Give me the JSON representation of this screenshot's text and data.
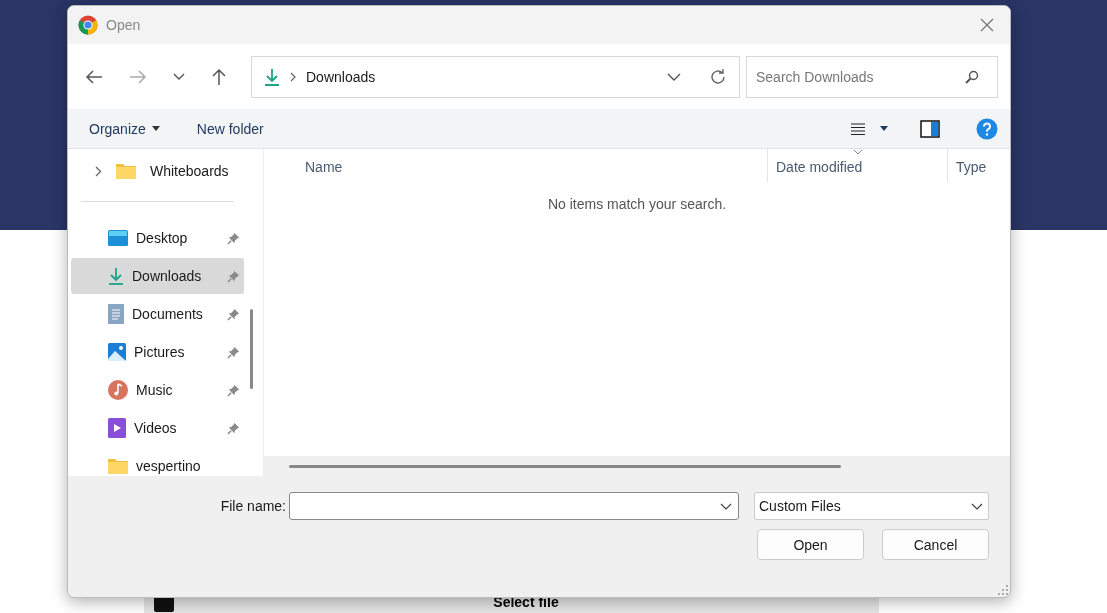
{
  "page": {
    "button": "Select file"
  },
  "dialog": {
    "title": "Open",
    "nav": {
      "path": "Downloads",
      "search_placeholder": "Search Downloads"
    },
    "toolbar": {
      "organize": "Organize",
      "new_folder": "New folder"
    },
    "sidebar": {
      "tree": [
        {
          "label": "Whiteboards",
          "kind": "folder",
          "expanded": false
        }
      ],
      "quick_access": [
        {
          "label": "Desktop",
          "kind": "desktop",
          "selected": false,
          "pinned": true
        },
        {
          "label": "Downloads",
          "kind": "downloads",
          "selected": true,
          "pinned": true
        },
        {
          "label": "Documents",
          "kind": "documents",
          "selected": false,
          "pinned": true
        },
        {
          "label": "Pictures",
          "kind": "pictures",
          "selected": false,
          "pinned": true
        },
        {
          "label": "Music",
          "kind": "music",
          "selected": false,
          "pinned": true
        },
        {
          "label": "Videos",
          "kind": "videos",
          "selected": false,
          "pinned": true
        },
        {
          "label": "vespertino",
          "kind": "folder",
          "selected": false,
          "pinned": false
        }
      ]
    },
    "columns": [
      {
        "label": "Name",
        "sorted": false
      },
      {
        "label": "Date modified",
        "sorted": true
      },
      {
        "label": "Type",
        "sorted": false
      }
    ],
    "empty_message": "No items match your search.",
    "footer": {
      "file_name_label": "File name:",
      "filter": "Custom Files",
      "buttons": [
        "Open",
        "Cancel"
      ]
    }
  }
}
